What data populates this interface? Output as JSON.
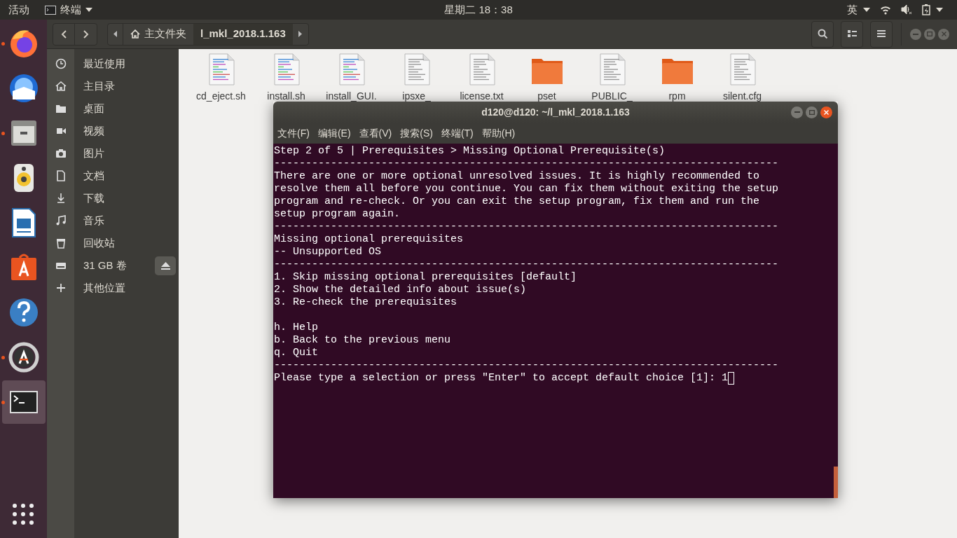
{
  "top_bar": {
    "activities": "活动",
    "app_menu": "终端",
    "clock": "星期二 18：38",
    "input_method": "英"
  },
  "dock": [
    {
      "kind": "firefox",
      "running": true,
      "selected": false
    },
    {
      "kind": "mail",
      "running": false,
      "selected": false
    },
    {
      "kind": "files",
      "running": true,
      "selected": false
    },
    {
      "kind": "speaker",
      "running": false,
      "selected": false
    },
    {
      "kind": "writer",
      "running": false,
      "selected": false
    },
    {
      "kind": "store",
      "running": false,
      "selected": false
    },
    {
      "kind": "help",
      "running": false,
      "selected": false
    },
    {
      "kind": "updater",
      "running": true,
      "selected": false
    },
    {
      "kind": "terminal",
      "running": true,
      "selected": true
    }
  ],
  "file_manager": {
    "path": [
      {
        "kind": "home",
        "label": "主文件夹",
        "selected": false
      },
      {
        "kind": "folder",
        "label": "l_mkl_2018.1.163",
        "selected": true
      }
    ],
    "sidebar": [
      {
        "kind": "clock",
        "label": "最近使用"
      },
      {
        "kind": "home",
        "label": "主目录"
      },
      {
        "kind": "folder",
        "label": "桌面"
      },
      {
        "kind": "video",
        "label": "视频"
      },
      {
        "kind": "camera",
        "label": "图片"
      },
      {
        "kind": "document",
        "label": "文档"
      },
      {
        "kind": "download",
        "label": "下载"
      },
      {
        "kind": "music",
        "label": "音乐"
      },
      {
        "kind": "trash",
        "label": "回收站"
      },
      {
        "kind": "drive",
        "label": "31 GB 卷",
        "ejectable": true
      },
      {
        "kind": "plus",
        "label": "其他位置"
      }
    ],
    "files": [
      {
        "kind": "script",
        "name": "cd_eject.sh"
      },
      {
        "kind": "script",
        "name": "install.sh"
      },
      {
        "kind": "script",
        "name": "install_GUI."
      },
      {
        "kind": "text",
        "name": "ipsxe_"
      },
      {
        "kind": "text",
        "name": "license.txt"
      },
      {
        "kind": "folder",
        "name": "pset"
      },
      {
        "kind": "text",
        "name": "PUBLIC_"
      },
      {
        "kind": "folder",
        "name": "rpm"
      },
      {
        "kind": "text",
        "name": "silent.cfg"
      }
    ]
  },
  "terminal": {
    "title": "d120@d120: ~/l_mkl_2018.1.163",
    "menu": [
      "文件(F)",
      "编辑(E)",
      "查看(V)",
      "搜索(S)",
      "终端(T)",
      "帮助(H)"
    ],
    "lines": [
      {
        "kind": "text",
        "text": "Step 2 of 5 | Prerequisites > Missing Optional Prerequisite(s)"
      },
      {
        "kind": "text",
        "text": "--------------------------------------------------------------------------------"
      },
      {
        "kind": "text",
        "text": "There are one or more optional unresolved issues. It is highly recommended to"
      },
      {
        "kind": "text",
        "text": "resolve them all before you continue. You can fix them without exiting the setup"
      },
      {
        "kind": "text",
        "text": "program and re-check. Or you can exit the setup program, fix them and run the"
      },
      {
        "kind": "text",
        "text": "setup program again."
      },
      {
        "kind": "text",
        "text": "--------------------------------------------------------------------------------"
      },
      {
        "kind": "text",
        "text": "Missing optional prerequisites"
      },
      {
        "kind": "text",
        "text": "-- Unsupported OS"
      },
      {
        "kind": "text",
        "text": "--------------------------------------------------------------------------------"
      },
      {
        "kind": "text",
        "text": "1. Skip missing optional prerequisites [default]"
      },
      {
        "kind": "text",
        "text": "2. Show the detailed info about issue(s)"
      },
      {
        "kind": "text",
        "text": "3. Re-check the prerequisites"
      },
      {
        "kind": "blank"
      },
      {
        "kind": "text",
        "text": "h. Help"
      },
      {
        "kind": "text",
        "text": "b. Back to the previous menu"
      },
      {
        "kind": "text",
        "text": "q. Quit"
      },
      {
        "kind": "text",
        "text": "--------------------------------------------------------------------------------"
      },
      {
        "kind": "prompt",
        "text": "Please type a selection or press \"Enter\" to accept default choice [1]: 1"
      }
    ]
  }
}
